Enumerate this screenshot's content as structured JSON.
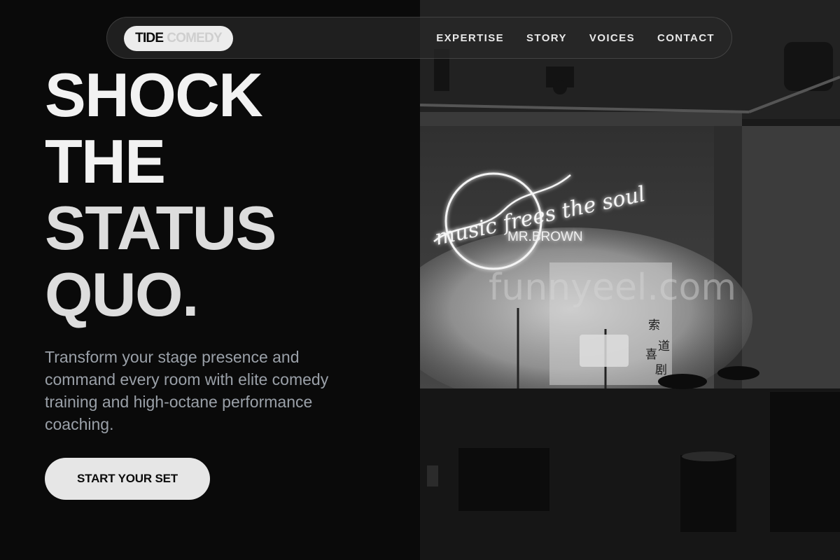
{
  "brand": {
    "name_primary": "TIDE",
    "name_secondary": "COMEDY"
  },
  "nav": {
    "links": [
      {
        "label": "EXPERTISE"
      },
      {
        "label": "STORY"
      },
      {
        "label": "VOICES"
      },
      {
        "label": "CONTACT"
      }
    ]
  },
  "hero": {
    "headline_lines": [
      "SHOCK",
      "THE",
      "STATUS",
      "QUO."
    ],
    "subtitle": "Transform your stage presence and command every room with elite comedy training and high-octane performance coaching.",
    "cta_label": "START YOUR SET"
  },
  "photo": {
    "neon_sign_script": "music frees the soul",
    "neon_sign_name": "MR.BROWN",
    "watermark": "funnyeel.com",
    "banner_characters": [
      "索",
      "道",
      "喜",
      "剧"
    ]
  },
  "colors": {
    "background": "#0b0b0b",
    "text": "#f2f2f2",
    "subtitle": "#9aa0a8",
    "button_bg": "#e6e6e6"
  }
}
